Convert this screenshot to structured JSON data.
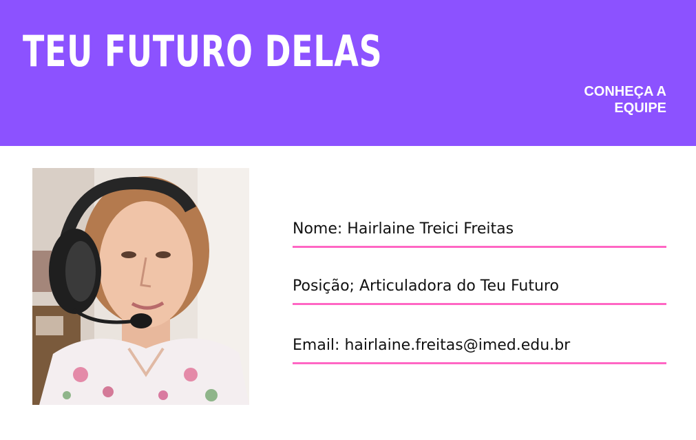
{
  "header": {
    "title": "TEU FUTURO DELAS",
    "team_link": "CONHEÇA A EQUIPE"
  },
  "profile": {
    "photo_alt": "",
    "name": "Nome: Hairlaine Treici Freitas",
    "position": "Posição; Articuladora do Teu Futuro",
    "email": "Email: hairlaine.freitas@imed.edu.br"
  },
  "colors": {
    "header_bg": "#8c52ff",
    "divider": "#ff66c4",
    "text": "#111111"
  }
}
